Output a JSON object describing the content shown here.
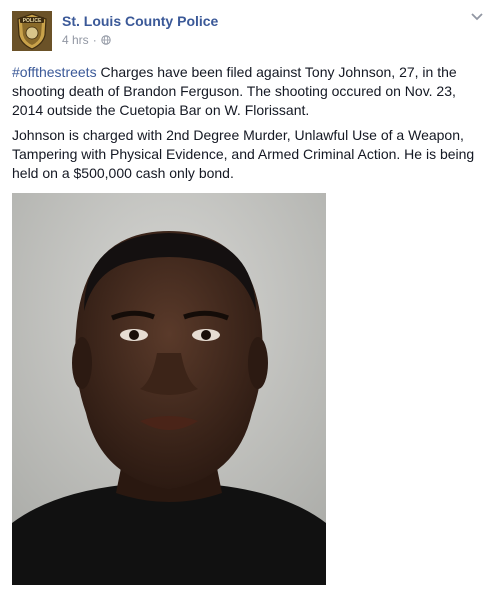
{
  "post": {
    "author": "St. Louis County Police",
    "timestamp": "4 hrs",
    "separator": "·",
    "privacy_icon": "globe-icon",
    "menu_icon": "chevron-down-icon",
    "hashtag": "#offthestreets",
    "paragraph1_rest": " Charges have been filed against Tony Johnson, 27, in the shooting death of Brandon Ferguson. The shooting occured on Nov. 23, 2014 outside the Cuetopia Bar on W. Florissant.",
    "paragraph2": "Johnson is charged with 2nd Degree Murder, Unlawful Use of a Weapon, Tampering with Physical Evidence, and Armed Criminal Action. He is being held on a $500,000 cash only bond.",
    "badge_text": "POLICE"
  },
  "colors": {
    "link": "#3b5998",
    "meta": "#9197a3",
    "text": "#141823"
  }
}
